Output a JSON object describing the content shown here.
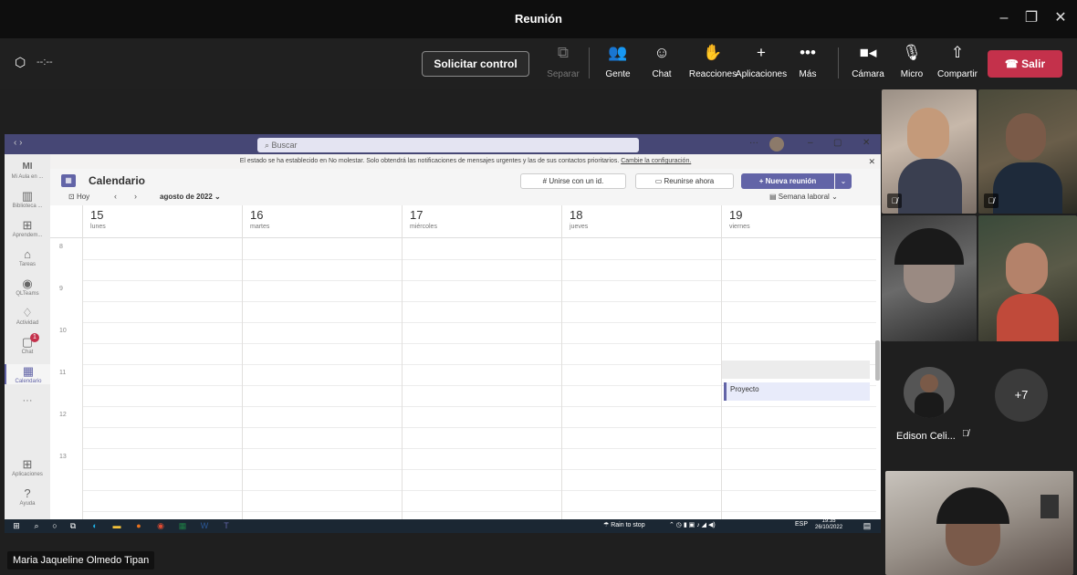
{
  "window": {
    "title": "Reunión"
  },
  "toolbar": {
    "timer": "--:--",
    "solicitar": "Solicitar control",
    "separar": "Separar",
    "gente": "Gente",
    "chat": "Chat",
    "reacciones": "Reacciones",
    "aplicaciones": "Aplicaciones",
    "mas": "Más",
    "camara": "Cámara",
    "micro": "Micro",
    "compartir": "Compartir",
    "salir": "Salir"
  },
  "shared": {
    "search_placeholder": "Buscar",
    "dnd_text": "El estado se ha establecido en No molestar. Solo obtendrá las notificaciones de mensajes urgentes y las de sus contactos prioritarios.",
    "dnd_link": "Cambie la configuración.",
    "calendar_title": "Calendario",
    "join_id": "Unirse con un id.",
    "join_now": "Reunirse ahora",
    "new_meeting": "Nueva reunión",
    "today": "Hoy",
    "month": "agosto de 2022",
    "view": "Semana laboral",
    "rail": [
      {
        "label": "Mi Aula en ...",
        "icon": "MI"
      },
      {
        "label": "Biblioteca ...",
        "icon": "▥"
      },
      {
        "label": "Aprendem...",
        "icon": "⊞"
      },
      {
        "label": "Tareas",
        "icon": "⌂"
      },
      {
        "label": "QLTeams",
        "icon": "◉"
      },
      {
        "label": "Actividad",
        "icon": "♢"
      },
      {
        "label": "Chat",
        "icon": "▢"
      },
      {
        "label": "Calendario",
        "icon": "▦"
      },
      {
        "label": "Aplicaciones",
        "icon": "⊞"
      },
      {
        "label": "Ayuda",
        "icon": "?"
      }
    ],
    "chat_badge": "1",
    "days": [
      {
        "num": "15",
        "name": "lunes"
      },
      {
        "num": "16",
        "name": "martes"
      },
      {
        "num": "17",
        "name": "miércoles"
      },
      {
        "num": "18",
        "name": "jueves"
      },
      {
        "num": "19",
        "name": "viernes"
      }
    ],
    "hours": [
      "8",
      "9",
      "10",
      "11",
      "12",
      "13"
    ],
    "event": "Proyecto",
    "taskbar": {
      "weather": "Rain to stop",
      "lang": "ESP",
      "time": "19:35",
      "date": "26/10/2022"
    }
  },
  "presenter_name": "Maria Jaqueline Olmedo Tipan",
  "gallery": {
    "participant_name": "Edison Celi...",
    "more": "+7"
  }
}
